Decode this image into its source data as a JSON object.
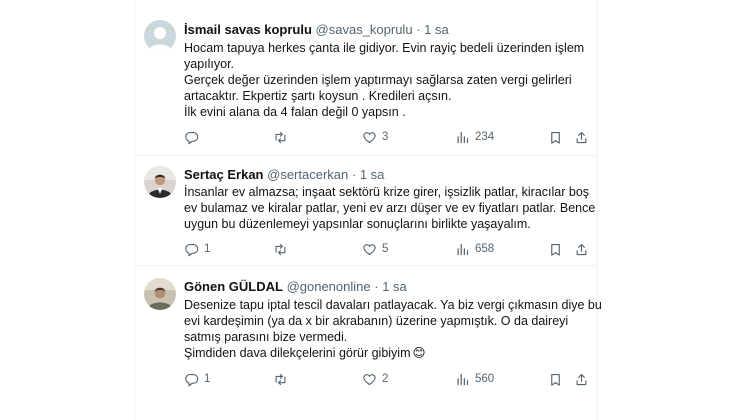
{
  "tweets": [
    {
      "name": "İsmail savas koprulu",
      "handle": "@savas_koprulu",
      "sep": "·",
      "time": "1 sa",
      "lines": [
        "Hocam tapuya herkes çanta ile gidiyor. Evin rayiç bedeli üzerinden işlem",
        "yapılıyor.",
        "Gerçek değer üzerinden işlem yaptırmayı sağlarsa zaten vergi gelirleri",
        "artacaktır. Ekpertiz şartı koysun . Kredileri açsın.",
        "İlk evini alana da 4 falan değil 0 yapsın ."
      ],
      "reply_count": "",
      "retweet_count": "",
      "like_count": "3",
      "view_count": "234"
    },
    {
      "name": "Sertaç Erkan",
      "handle": "@sertacerkan",
      "sep": "·",
      "time": "1 sa",
      "lines": [
        "İnsanlar ev almazsa; inşaat sektörü krize girer, işsizlik patlar, kiracılar boş",
        "ev bulamaz ve kiralar patlar, yeni ev arzı düşer ve ev fiyatları patlar. Bence",
        "uygun bu düzenlemeyi yapsınlar sonuçlarını birlikte yaşayalım."
      ],
      "reply_count": "1",
      "retweet_count": "",
      "like_count": "5",
      "view_count": "658"
    },
    {
      "name": "Gönen GÜLDAL",
      "handle": "@gonenonline",
      "sep": "·",
      "time": "1 sa",
      "lines": [
        "Desenize tapu iptal tescil davaları patlayacak. Ya biz vergi çıkmasın diye bu",
        "evi kardeşimin (ya da x bir akrabanın) üzerine yapmıştık. O da daireyi",
        "satmış parasını bize vermedi.",
        "Şimdiden dava dilekçelerini görür gibiyim"
      ],
      "emoji": "😊",
      "reply_count": "1",
      "retweet_count": "",
      "like_count": "2",
      "view_count": "560"
    }
  ],
  "colors": {
    "text": "#0f1419",
    "secondary": "#536471",
    "border": "#eff3f4",
    "default_avatar": "#c4cfd6"
  },
  "icons": [
    "default-avatar-icon",
    "reply-icon",
    "retweet-icon",
    "like-icon",
    "views-icon",
    "bookmark-icon",
    "share-icon"
  ]
}
